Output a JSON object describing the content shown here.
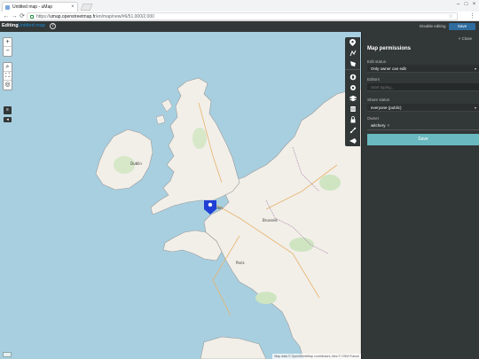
{
  "browser": {
    "tab_title": "Untitled map - uMap",
    "url_scheme": "https://",
    "url_host": "umap.openstreetmap.fr",
    "url_path": "/en/map/new/#6/51.000/2.000",
    "close_glyph": "×",
    "back_glyph": "←",
    "forward_glyph": "→",
    "reload_glyph": "⟳",
    "star_glyph": "☆",
    "menu_glyph": "⋮",
    "minimize_glyph": "–",
    "maximize_glyph": "□",
    "winclose_glyph": "×"
  },
  "topbar": {
    "editing_label": "Editing",
    "map_name": "Untitled map",
    "help_glyph": "?",
    "disable_editing_label": "Disable editing",
    "save_label": "Save"
  },
  "map": {
    "zoom_in": "+",
    "zoom_out": "−",
    "search_glyph": "⌕",
    "fullscreen_glyph": "⛶",
    "locate_glyph": "◎",
    "layers_glyph": "≡",
    "more_glyph": "◂",
    "attribution": "Map data © OpenStreetMap contributors, tiles © OSM France",
    "marker_color": "#1f3fd6",
    "sea_color": "#a8cfe0",
    "land_color": "#f2efe9",
    "labels": {
      "dublin": "Dublin",
      "london": "London",
      "paris": "Paris",
      "brussels": "Brussels"
    }
  },
  "edit_toolbar": {
    "icons": [
      "marker-icon",
      "polyline-icon",
      "polygon-icon",
      "center-icon",
      "settings-icon",
      "layers-icon",
      "datalayers-icon",
      "permissions-icon",
      "tilelayer-icon",
      "import-icon"
    ]
  },
  "panel": {
    "close_label": "Close",
    "title": "Map permissions",
    "edit_status_label": "Edit status",
    "edit_status_value": "Only owner can edit",
    "editors_label": "Editors",
    "editors_placeholder": "Start typing...",
    "share_status_label": "Share status",
    "share_status_value": "everyone (public)",
    "owner_label": "Owner",
    "owner_value": "witchery",
    "owner_remove_glyph": "×",
    "caret_glyph": "▾",
    "save_label": "Save"
  }
}
